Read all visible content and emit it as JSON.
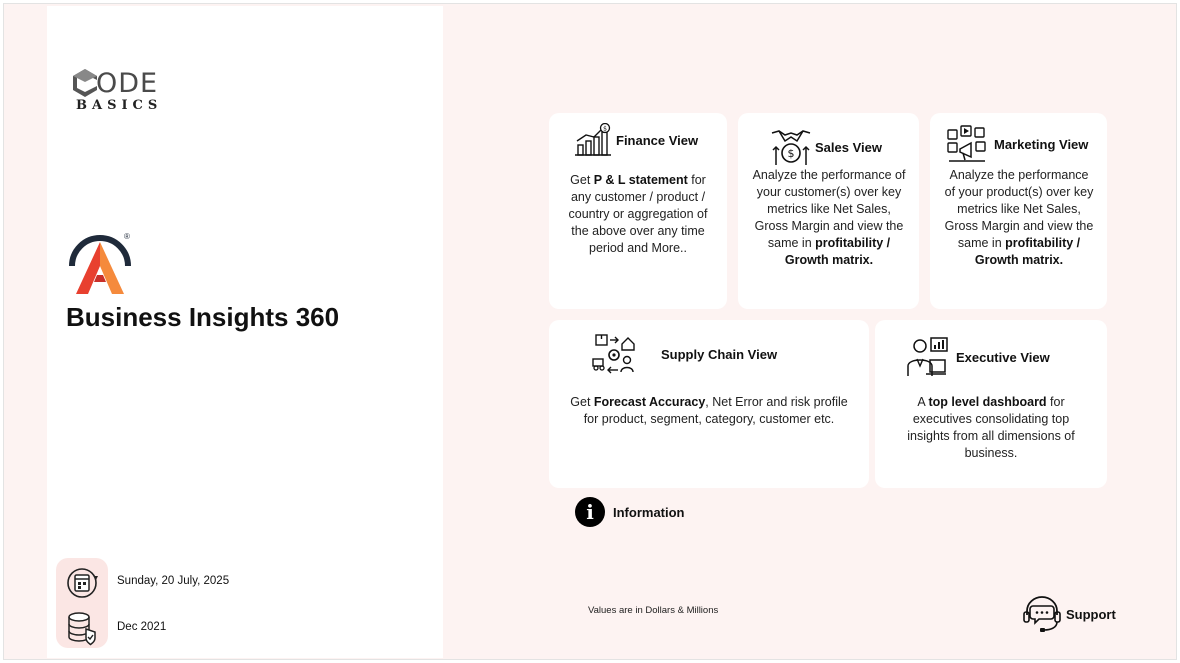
{
  "brand": {
    "logo_main": "ODE",
    "logo_sub": "BASICS",
    "mark_registered": "®",
    "app_title": "Business Insights 360"
  },
  "sidebar": {
    "current_date": "Sunday, 20 July, 2025",
    "data_refresh": "Dec 2021"
  },
  "cards": {
    "finance": {
      "title": "Finance View",
      "body_pre": "Get ",
      "body_bold": "P & L statement",
      "body_post": " for any customer / product / country or aggregation of the above over any time period and More.."
    },
    "sales": {
      "title": "Sales View",
      "body_pre": "Analyze the performance of your customer(s) over key metrics like Net Sales, Gross Margin and view the same in ",
      "body_bold": "profitability / Growth matrix."
    },
    "marketing": {
      "title": "Marketing View",
      "body_pre": "Analyze the performance of your product(s) over key metrics like Net Sales, Gross Margin and view the same in ",
      "body_bold": "profitability / Growth matrix."
    },
    "supply_chain": {
      "title": "Supply Chain View",
      "body_pre": "Get ",
      "body_bold": "Forecast Accuracy",
      "body_post": ", Net Error and risk profile for product, segment, category, customer etc."
    },
    "executive": {
      "title": "Executive View",
      "body_pre": "A ",
      "body_bold": "top level dashboard",
      "body_post": " for executives consolidating top insights from all dimensions of business."
    }
  },
  "footer": {
    "info_glyph": "i",
    "info_label": "Information",
    "values_note": "Values are in Dollars & Millions",
    "support_label": "Support"
  },
  "colors": {
    "background": "#fdf3f2",
    "panel": "#ffffff",
    "side_strip": "#fbe6e4",
    "accent_red": "#e8402f",
    "accent_orange": "#f58a3c",
    "dark_navy": "#1f2a3a"
  },
  "icons": {
    "finance": "finance-growth-icon",
    "sales": "handshake-money-icon",
    "marketing": "marketing-media-icon",
    "supply_chain": "supply-chain-icon",
    "executive": "executive-presenter-icon",
    "calendar": "calendar-refresh-icon",
    "database": "database-shield-icon",
    "info": "info-icon",
    "support": "headset-chat-icon"
  }
}
